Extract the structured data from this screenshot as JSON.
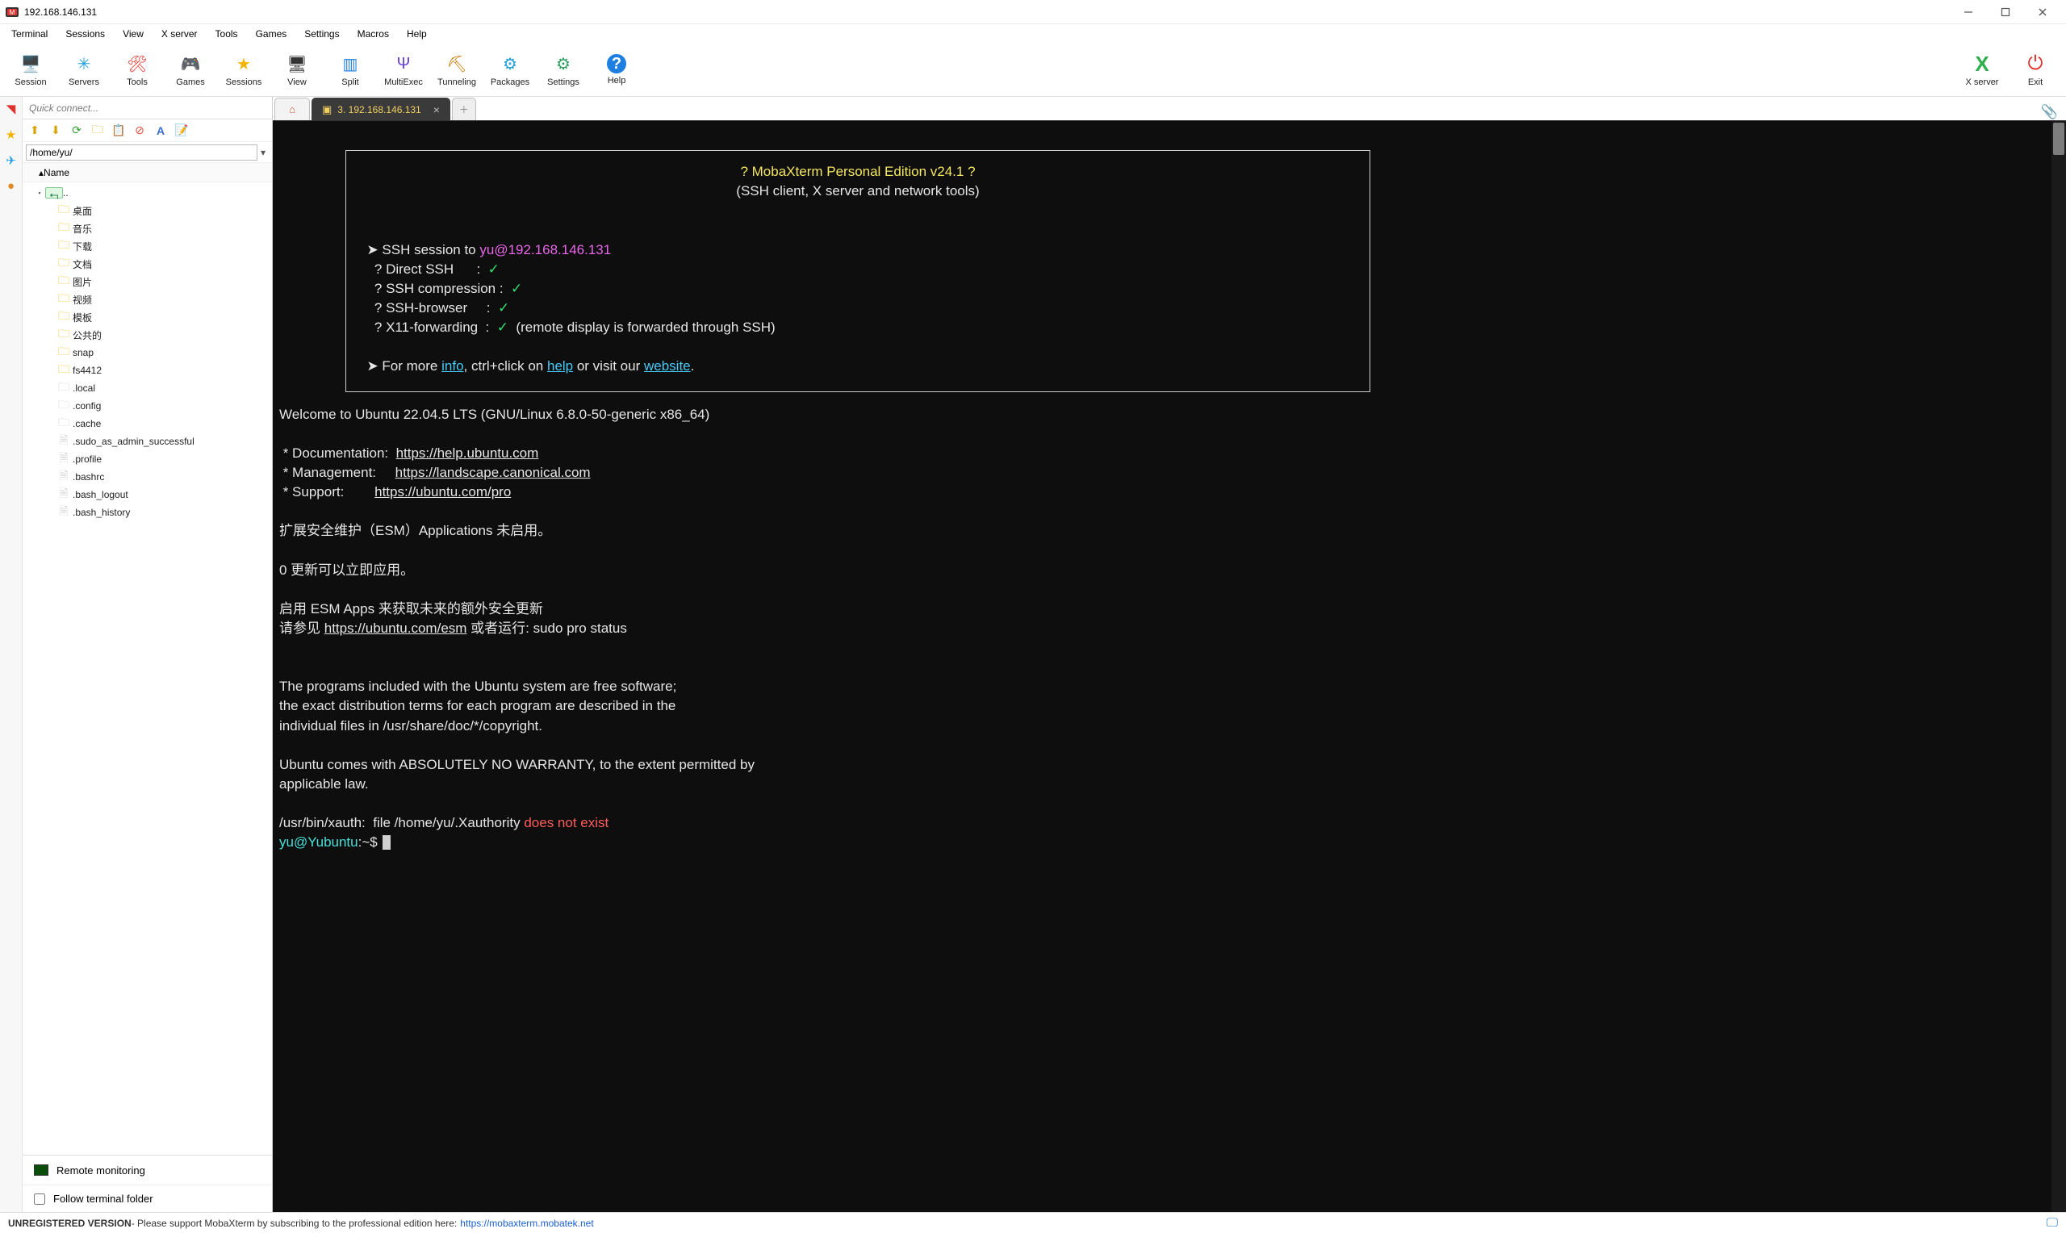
{
  "window": {
    "title": "192.168.146.131"
  },
  "menubar": [
    "Terminal",
    "Sessions",
    "View",
    "X server",
    "Tools",
    "Games",
    "Settings",
    "Macros",
    "Help"
  ],
  "toolbar": [
    {
      "name": "session",
      "label": "Session",
      "glyph": "🖥️",
      "color": "#1f7fe0"
    },
    {
      "name": "servers",
      "label": "Servers",
      "glyph": "✳",
      "color": "#1f9fe0"
    },
    {
      "name": "tools",
      "label": "Tools",
      "glyph": "🛠",
      "color": "#e03a2f"
    },
    {
      "name": "games",
      "label": "Games",
      "glyph": "🎮",
      "color": "#5aaf2f"
    },
    {
      "name": "sessions",
      "label": "Sessions",
      "glyph": "★",
      "color": "#f3b301"
    },
    {
      "name": "view",
      "label": "View",
      "glyph": "🖥",
      "color": "#333"
    },
    {
      "name": "split",
      "label": "Split",
      "glyph": "▥",
      "color": "#1f7fe0"
    },
    {
      "name": "multiexec",
      "label": "MultiExec",
      "glyph": "Ψ",
      "color": "#6a3fd0"
    },
    {
      "name": "tunneling",
      "label": "Tunneling",
      "glyph": "⛏",
      "color": "#c97a00"
    },
    {
      "name": "packages",
      "label": "Packages",
      "glyph": "⚙",
      "color": "#1f9fe0"
    },
    {
      "name": "settings",
      "label": "Settings",
      "glyph": "⚙",
      "color": "#2f9f5f"
    },
    {
      "name": "help",
      "label": "Help",
      "glyph": "?",
      "color": "#1f7fe0"
    }
  ],
  "toolbar_right": [
    {
      "name": "xserver",
      "label": "X server",
      "glyph": "X",
      "color": "#2fae4d"
    },
    {
      "name": "exit",
      "label": "Exit",
      "glyph": "⏻",
      "color": "#e0332f"
    }
  ],
  "sidebar": {
    "quick_connect_placeholder": "Quick connect...",
    "path": "/home/yu/",
    "tree_header": "Name",
    "up_label": "..",
    "folders": [
      "桌面",
      "音乐",
      "下载",
      "文档",
      "图片",
      "视频",
      "模板",
      "公共的",
      "snap",
      "fs4412"
    ],
    "hidden_folders": [
      ".local",
      ".config",
      ".cache"
    ],
    "files": [
      ".sudo_as_admin_successful",
      ".profile",
      ".bashrc",
      ".bash_logout",
      ".bash_history"
    ],
    "remote_monitoring": "Remote monitoring",
    "follow_label": "Follow terminal folder"
  },
  "tabs": {
    "active_label": "3. 192.168.146.131"
  },
  "terminal": {
    "banner_title": "? MobaXterm Personal Edition v24.1 ?",
    "banner_sub": "(SSH client, X server and network tools)",
    "ssh_to_prefix": "SSH session to ",
    "ssh_target": "yu@192.168.146.131",
    "feat1": "? Direct SSH      :",
    "feat2": "? SSH compression :",
    "feat3": "? SSH-browser     :",
    "feat4": "? X11-forwarding  :",
    "feat4_note": "  (remote display is forwarded through SSH)",
    "more_prefix": "For more ",
    "info": "info",
    "more_mid": ", ctrl+click on ",
    "help": "help",
    "more_mid2": " or visit our ",
    "website": "website",
    "welcome": "Welcome to Ubuntu 22.04.5 LTS (GNU/Linux 6.8.0-50-generic x86_64)",
    "doc_label": " * Documentation:  ",
    "doc_url": "https://help.ubuntu.com",
    "mgmt_label": " * Management:     ",
    "mgmt_url": "https://landscape.canonical.com",
    "sup_label": " * Support:        ",
    "sup_url": "https://ubuntu.com/pro",
    "esm1": "扩展安全维护（ESM）Applications 未启用。",
    "updates": "0 更新可以立即应用。",
    "esm2": "启用 ESM Apps 来获取未来的额外安全更新",
    "esm3_pre": "请参见 ",
    "esm3_url": "https://ubuntu.com/esm",
    "esm3_post": " 或者运行: sudo pro status",
    "progs1": "The programs included with the Ubuntu system are free software;",
    "progs2": "the exact distribution terms for each program are described in the",
    "progs3": "individual files in /usr/share/doc/*/copyright.",
    "warr1": "Ubuntu comes with ABSOLUTELY NO WARRANTY, to the extent permitted by",
    "warr2": "applicable law.",
    "xauth_pre": "/usr/bin/xauth:  file /home/yu/.Xauthority ",
    "xauth_err": "does not exist",
    "prompt": "yu@Yubuntu",
    "prompt_path": ":~$ "
  },
  "status": {
    "unreg": "UNREGISTERED VERSION",
    "msg": "  -  Please support MobaXterm by subscribing to the professional edition here:",
    "url": "https://mobaxterm.mobatek.net"
  }
}
